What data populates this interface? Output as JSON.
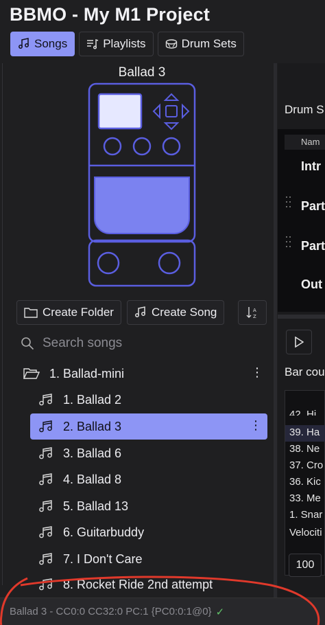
{
  "app": {
    "title": "BBMO - My M1 Project"
  },
  "tabs": [
    {
      "label": "Songs",
      "icon": "music-note-icon",
      "active": true
    },
    {
      "label": "Playlists",
      "icon": "playlist-icon",
      "active": false
    },
    {
      "label": "Drum Sets",
      "icon": "drum-icon",
      "active": false
    }
  ],
  "pedal": {
    "song_name": "Ballad 3"
  },
  "actions": {
    "create_folder": "Create Folder",
    "create_song": "Create Song",
    "sort_icon": "sort-az-icon"
  },
  "search": {
    "placeholder": "Search songs"
  },
  "tree": {
    "folder": {
      "label": "1. Ballad-mini",
      "icon": "folder-open-icon"
    },
    "songs": [
      {
        "label": "1. Ballad 2"
      },
      {
        "label": "2. Ballad 3",
        "selected": true
      },
      {
        "label": "3. Ballad 6"
      },
      {
        "label": "4. Ballad 8"
      },
      {
        "label": "5. Ballad 13"
      },
      {
        "label": "6. Guitarbuddy"
      },
      {
        "label": "7. I Don't Care"
      },
      {
        "label": "8. Rocket Ride 2nd attempt"
      }
    ]
  },
  "status": {
    "text": "Ballad 3 - CC0:0 CC32:0 PC:1 {PC0:0:1@0}",
    "ok": "✓"
  },
  "right_panel": {
    "title": "Drum S",
    "table_header": "Nam",
    "parts": [
      "Intr",
      "Part",
      "Part",
      "Out"
    ],
    "bar_count_label": "Bar cou",
    "instruments": [
      "42. Hi",
      "39. Ha",
      "38. Ne",
      "37. Cro",
      "36. Kic",
      "33. Me",
      "1. Snar"
    ],
    "velocity_label": "Velociti",
    "velocity_value": "100"
  },
  "colors": {
    "accent": "#8d95f5",
    "background": "#1f1f21",
    "pedal_outline": "#5a5ee0",
    "pedal_fill": "#7b82f0",
    "annotation": "#e0392b"
  }
}
